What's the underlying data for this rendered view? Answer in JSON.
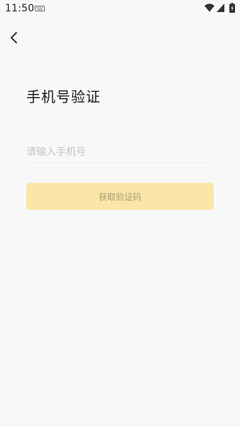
{
  "status_bar": {
    "time": "11:50",
    "icons": [
      "keyboard-icon",
      "wifi-icon",
      "signal-icon",
      "battery-icon"
    ]
  },
  "header": {
    "back_icon": "chevron-left-icon"
  },
  "page": {
    "title": "手机号验证"
  },
  "form": {
    "phone_placeholder": "请输入手机号",
    "phone_value": "",
    "submit_label": "获取验证码"
  },
  "colors": {
    "background": "#f8f8f9",
    "button_bg": "#fbe6a8",
    "button_text": "#a89a72",
    "placeholder": "#c4c4c4"
  }
}
